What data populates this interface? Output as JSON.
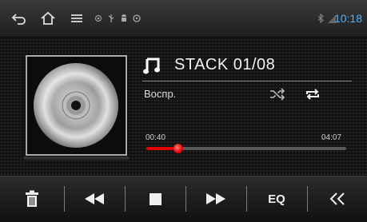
{
  "status_bar": {
    "icons": [
      "back-icon",
      "home-icon",
      "menu-icon",
      "gps-icon",
      "usb-icon",
      "android-icon",
      "steering-wheel-icon",
      "bluetooth-icon",
      "signal-icon"
    ],
    "clock": "10:18",
    "clock_color": "#4ab3ff"
  },
  "track": {
    "title": "STACK 01/08",
    "status": "Воспр.",
    "current_time": "00:40",
    "total_time": "04:07",
    "progress": 0.16
  },
  "controls": {
    "eq_label": "EQ",
    "icons": [
      "delete-icon",
      "previous-icon",
      "stop-icon",
      "next-icon",
      "equalizer-button",
      "collapse-icon"
    ]
  },
  "colors": {
    "accent": "#e00000",
    "clock": "#4ab3ff"
  }
}
